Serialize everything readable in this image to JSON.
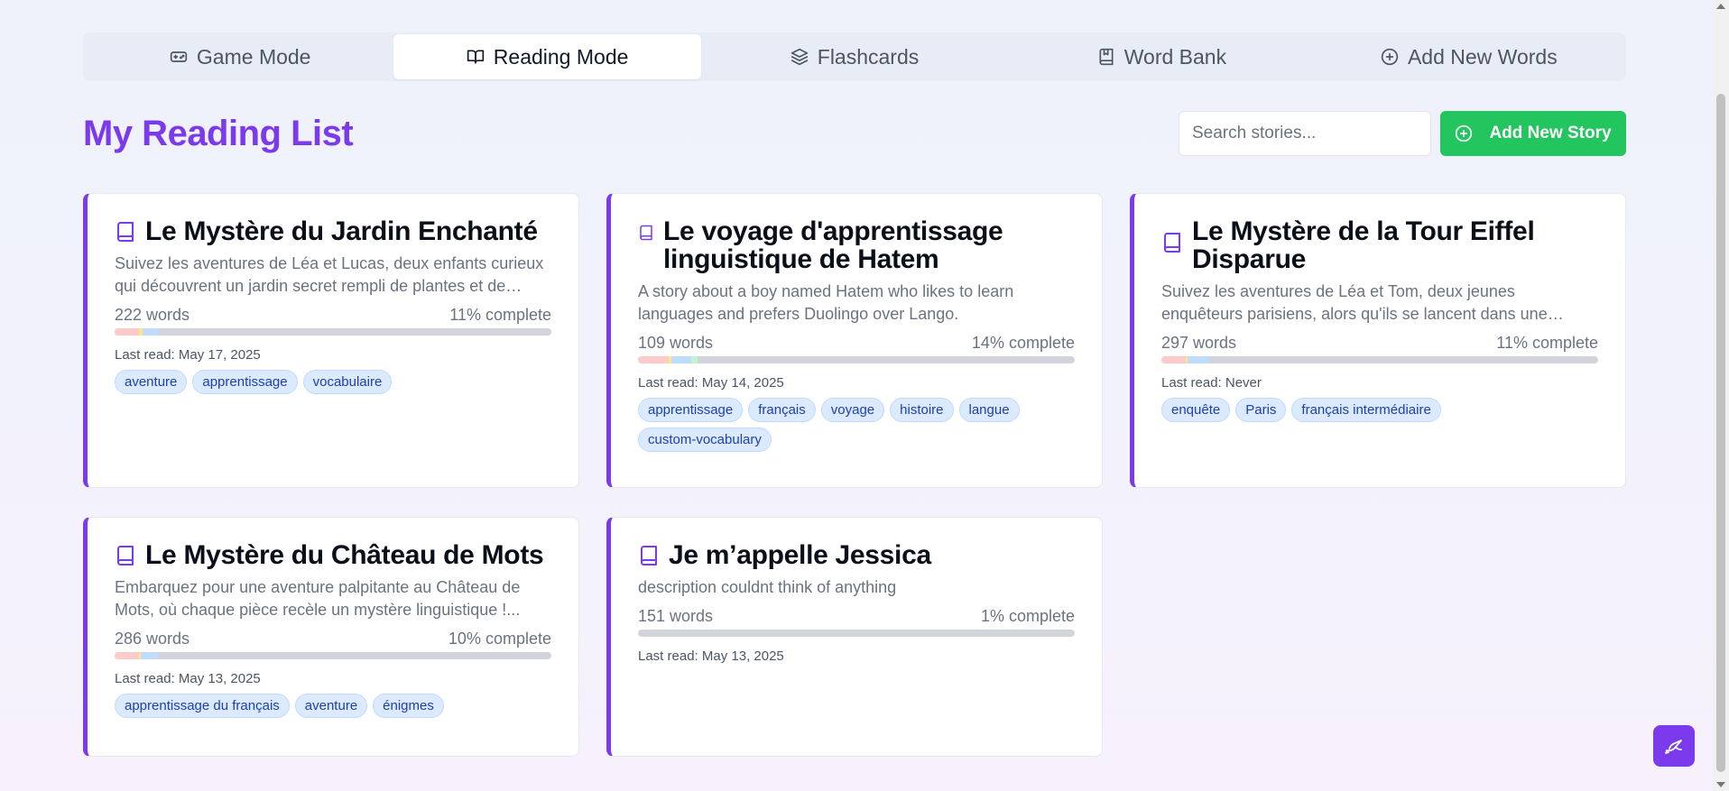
{
  "tabs": [
    {
      "label": "Game Mode",
      "icon": "gamepad-icon"
    },
    {
      "label": "Reading Mode",
      "icon": "book-open-icon"
    },
    {
      "label": "Flashcards",
      "icon": "layers-icon"
    },
    {
      "label": "Word Bank",
      "icon": "bookmark-book-icon"
    },
    {
      "label": "Add New Words",
      "icon": "plus-circle-icon"
    }
  ],
  "active_tab": "Reading Mode",
  "header": {
    "title": "My Reading List",
    "search_placeholder": "Search stories...",
    "add_story_label": "Add New Story"
  },
  "colors": {
    "accent": "#7c3aed",
    "primary_button": "#22c55e",
    "tag_text": "#1e40af",
    "tag_bg": "#dbeafe"
  },
  "stories": [
    {
      "title": "Le Mystère du Jardin Enchanté",
      "description": "Suivez les aventures de Léa et Lucas, deux enfants curieux qui découvrent un jardin secret rempli de plantes et de créatures magiques.",
      "words": "222 words",
      "complete": "11% complete",
      "progress": {
        "red": 5.5,
        "yellow": 1.0,
        "blue": 3.5,
        "green": 0
      },
      "last_read": "Last read: May 17, 2025",
      "tags": [
        "aventure",
        "apprentissage",
        "vocabulaire"
      ]
    },
    {
      "title": "Le voyage d'apprentissage linguistique de Hatem",
      "description": "A story about a boy named Hatem who likes to learn languages and prefers Duolingo over Lango.",
      "words": "109 words",
      "complete": "14% complete",
      "progress": {
        "red": 7.0,
        "yellow": 0.7,
        "blue": 4.5,
        "green": 1.5
      },
      "last_read": "Last read: May 14, 2025",
      "tags": [
        "apprentissage",
        "français",
        "voyage",
        "histoire",
        "langue",
        "custom-vocabulary"
      ]
    },
    {
      "title": "Le Mystère de la Tour Eiffel Disparue",
      "description": "Suivez les aventures de Léa et Tom, deux jeunes enquêteurs parisiens, alors qu'ils se lancent dans une enquête palpitante.",
      "words": "297 words",
      "complete": "11% complete",
      "progress": {
        "red": 5.5,
        "yellow": 0.5,
        "blue": 5.0,
        "green": 0
      },
      "last_read": "Last read: Never",
      "tags": [
        "enquête",
        "Paris",
        "français intermédiaire"
      ]
    },
    {
      "title": "Le Mystère du Château de Mots",
      "description": "Embarquez pour une aventure palpitante au Château de Mots, où chaque pièce recèle un mystère linguistique !...",
      "words": "286 words",
      "complete": "10% complete",
      "progress": {
        "red": 5.5,
        "yellow": 0.5,
        "blue": 4.0,
        "green": 0
      },
      "last_read": "Last read: May 13, 2025",
      "tags": [
        "apprentissage du français",
        "aventure",
        "énigmes"
      ]
    },
    {
      "title": "Je m’appelle Jessica",
      "description": "description couldnt think of anything",
      "words": "151 words",
      "complete": "1% complete",
      "progress": {
        "red": 0,
        "yellow": 0,
        "blue": 0,
        "green": 0
      },
      "last_read": "Last read: May 13, 2025",
      "tags": []
    }
  ]
}
